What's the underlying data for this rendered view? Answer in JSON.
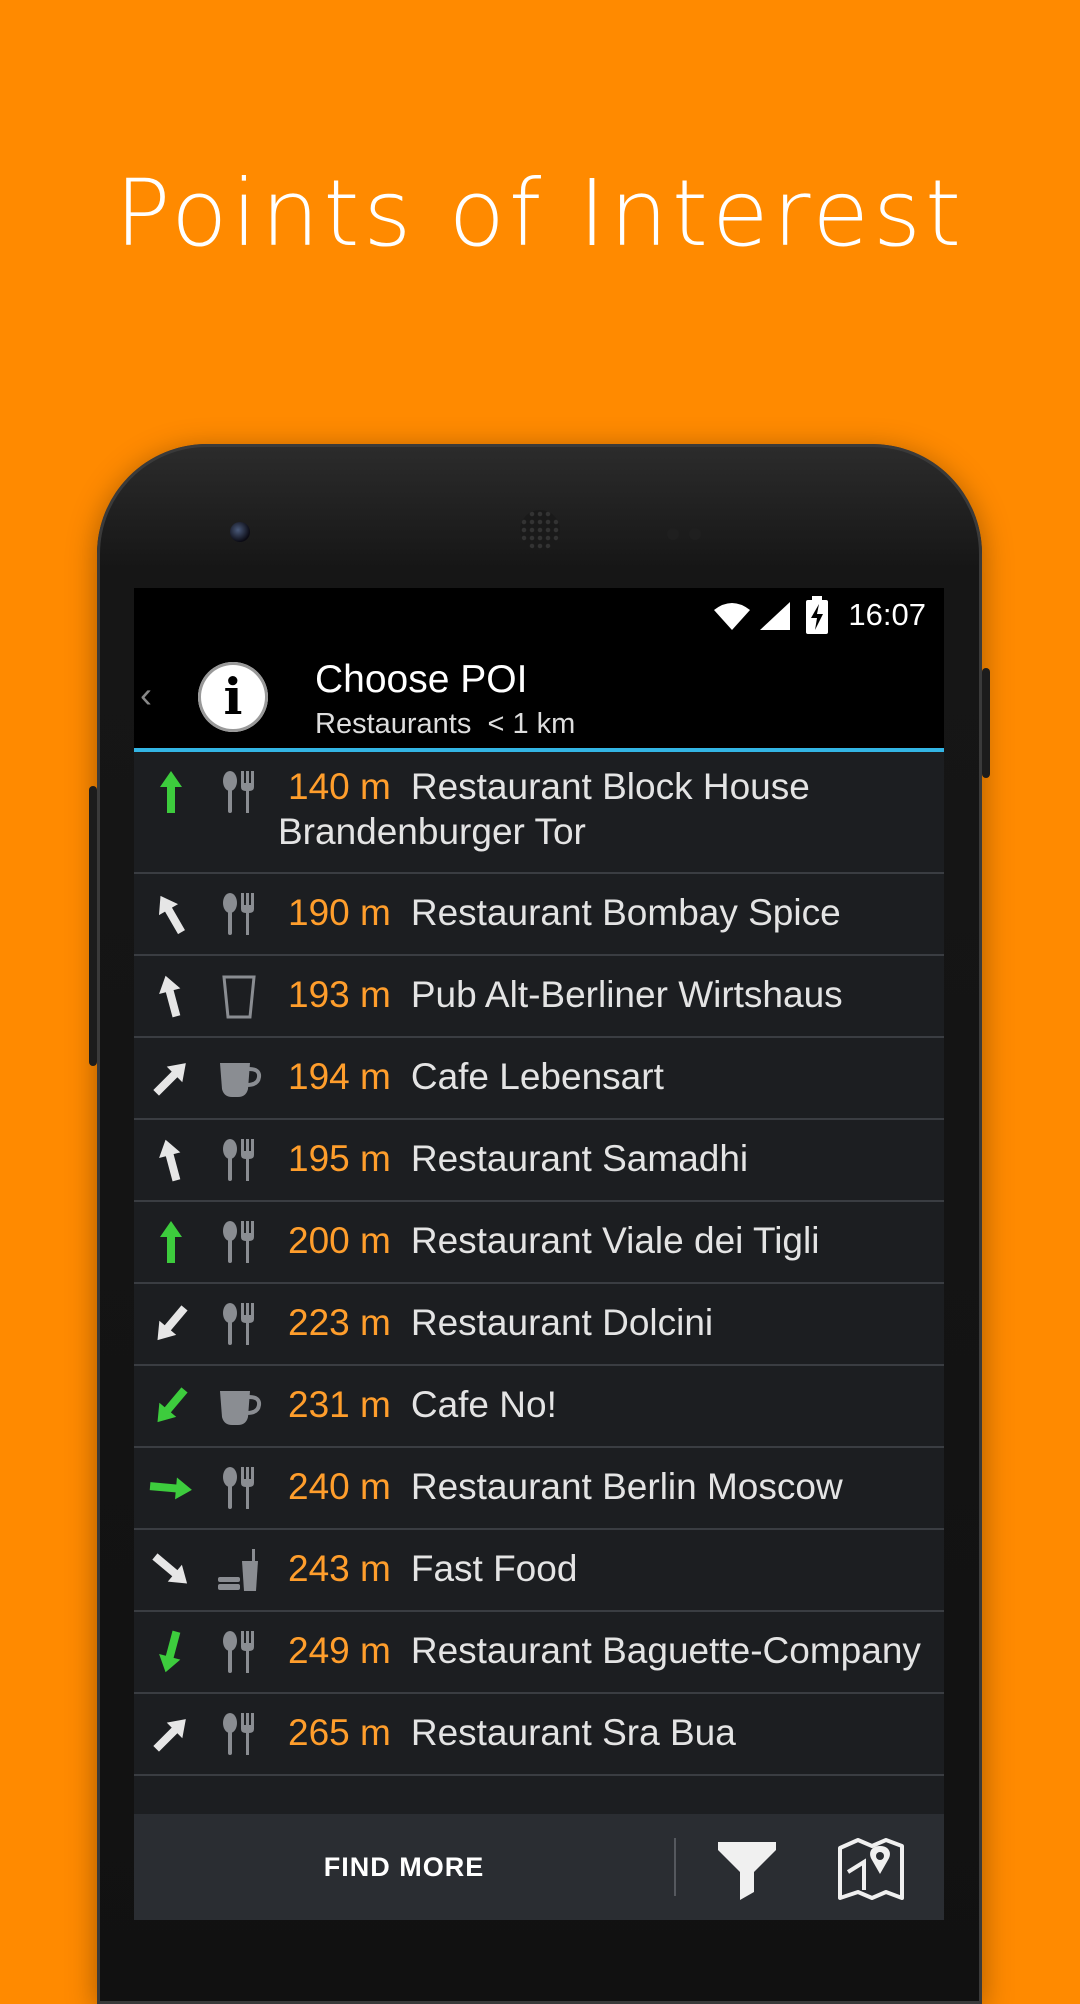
{
  "headline": "Points of Interest",
  "status_bar": {
    "time": "16:07",
    "icons": [
      "wifi-icon",
      "signal-icon",
      "battery-charging-icon"
    ]
  },
  "app_bar": {
    "title": "Choose POI",
    "subtitle": "Restaurants  < 1 km",
    "back_icon": "chevron-left-icon",
    "info_glyph": "i"
  },
  "poi_list": [
    {
      "distance": "140 m",
      "name": "Restaurant Block House Brandenburger Tor",
      "category": "restaurant",
      "direction": "up",
      "arrow_color": "#3DCC3D"
    },
    {
      "distance": "190 m",
      "name": "Restaurant Bombay Spice",
      "category": "restaurant",
      "direction": "up-left",
      "arrow_color": "#E6E6E6"
    },
    {
      "distance": "193 m",
      "name": "Pub Alt-Berliner Wirtshaus",
      "category": "pub",
      "direction": "up-slight-left",
      "arrow_color": "#E6E6E6"
    },
    {
      "distance": "194 m",
      "name": "Cafe Lebensart",
      "category": "cafe",
      "direction": "up-right",
      "arrow_color": "#E6E6E6"
    },
    {
      "distance": "195 m",
      "name": "Restaurant Samadhi",
      "category": "restaurant",
      "direction": "up-slight-left",
      "arrow_color": "#E6E6E6"
    },
    {
      "distance": "200 m",
      "name": "Restaurant Viale dei Tigli",
      "category": "restaurant",
      "direction": "up",
      "arrow_color": "#3DCC3D"
    },
    {
      "distance": "223 m",
      "name": "Restaurant Dolcini",
      "category": "restaurant",
      "direction": "down-left",
      "arrow_color": "#E6E6E6"
    },
    {
      "distance": "231 m",
      "name": "Cafe No!",
      "category": "cafe",
      "direction": "down-left",
      "arrow_color": "#3DCC3D"
    },
    {
      "distance": "240 m",
      "name": "Restaurant Berlin Moscow",
      "category": "restaurant",
      "direction": "right",
      "arrow_color": "#3DCC3D"
    },
    {
      "distance": "243 m",
      "name": "Fast Food",
      "category": "fast-food",
      "direction": "down-right",
      "arrow_color": "#E6E6E6"
    },
    {
      "distance": "249 m",
      "name": "Restaurant Baguette-Company",
      "category": "restaurant",
      "direction": "down-slight-left",
      "arrow_color": "#3DCC3D"
    },
    {
      "distance": "265 m",
      "name": "Restaurant Sra Bua",
      "category": "restaurant",
      "direction": "up-right",
      "arrow_color": "#E6E6E6"
    }
  ],
  "bottom_bar": {
    "find_more_label": "FIND MORE",
    "filter_icon": "filter-icon",
    "map_icon": "map-pin-icon"
  },
  "colors": {
    "background": "#FF8A00",
    "accent_line": "#33B5E5",
    "distance_text": "#FF9E2C"
  }
}
